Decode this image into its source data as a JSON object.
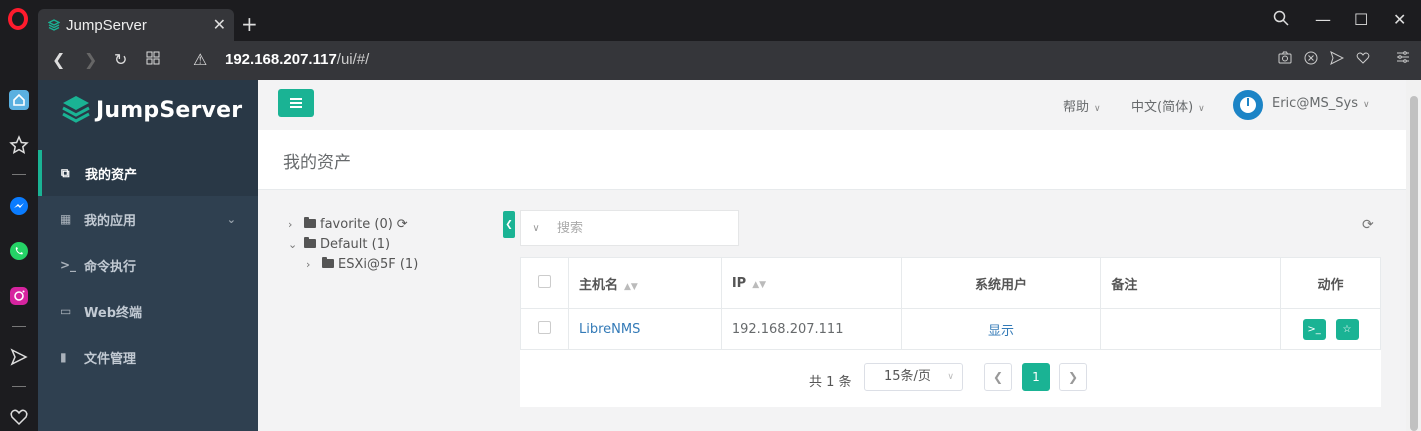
{
  "browser": {
    "tab_title": "JumpServer",
    "url_host": "192.168.207.117",
    "url_path": "/ui/#/"
  },
  "icons": {
    "opera": "opera-logo-icon",
    "home": "home-icon",
    "star": "star-icon",
    "messenger": "messenger-icon",
    "whatsapp": "whatsapp-icon",
    "instagram": "instagram-icon",
    "send": "send-icon",
    "heart": "heart-icon"
  },
  "colors": {
    "accent": "#1ab394",
    "nav_bg": "#2f4050",
    "link": "#337ab7"
  },
  "app": {
    "brand": "JumpServer"
  },
  "nav": {
    "items": [
      {
        "label": "我的资产",
        "icon": "assets-icon",
        "active": true
      },
      {
        "label": "我的应用",
        "icon": "grid-icon"
      },
      {
        "label": "命令执行",
        "icon": "terminal-icon"
      },
      {
        "label": "Web终端",
        "icon": "window-icon"
      },
      {
        "label": "文件管理",
        "icon": "file-icon"
      }
    ]
  },
  "header": {
    "help": "帮助",
    "language": "中文(简体)",
    "user": "Eric@MS_Sys"
  },
  "page": {
    "title": "我的资产"
  },
  "tree": {
    "nodes": [
      {
        "label": "favorite (0)"
      },
      {
        "label": "Default (1)"
      },
      {
        "label": "ESXi@5F (1)"
      }
    ]
  },
  "search": {
    "placeholder": "搜索"
  },
  "table": {
    "headers": [
      "主机名",
      "IP",
      "系统用户",
      "备注",
      "动作"
    ],
    "rows": [
      {
        "hostname": "LibreNMS",
        "ip": "192.168.207.111",
        "system_user": "显示",
        "note": ""
      }
    ]
  },
  "pager": {
    "total": "共 1 条",
    "page_size": "15条/页",
    "current_page": "1"
  }
}
